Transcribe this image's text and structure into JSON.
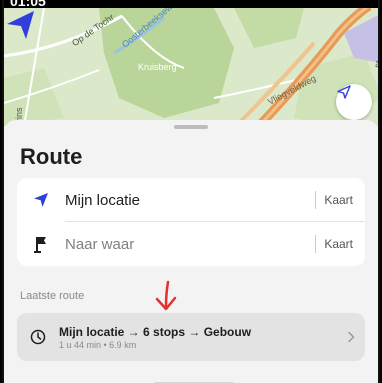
{
  "status_bar": {
    "fragment": "01:05"
  },
  "map": {
    "labels": {
      "street_1": "Op de Tochr",
      "water": "Oosterbeekseweg",
      "area": "Kruisberg",
      "road": "Vliegveldweg",
      "street_2": "Prins",
      "edge": "st"
    }
  },
  "sheet": {
    "title": "Route",
    "origin": {
      "value": "Mijn locatie",
      "map_label": "Kaart"
    },
    "destination": {
      "placeholder": "Naar waar",
      "map_label": "Kaart"
    },
    "recent_section_label": "Laatste route",
    "recent_route": {
      "summary": "Mijn locatie → 6 stops → Gebouw",
      "meta": "1 u 44 min • 6.9 km"
    }
  },
  "colors": {
    "accent_blue": "#2f3fd9",
    "annotation_red": "#e53030",
    "map_green": "#c9dfb0",
    "highway_orange": "#e79a55"
  }
}
